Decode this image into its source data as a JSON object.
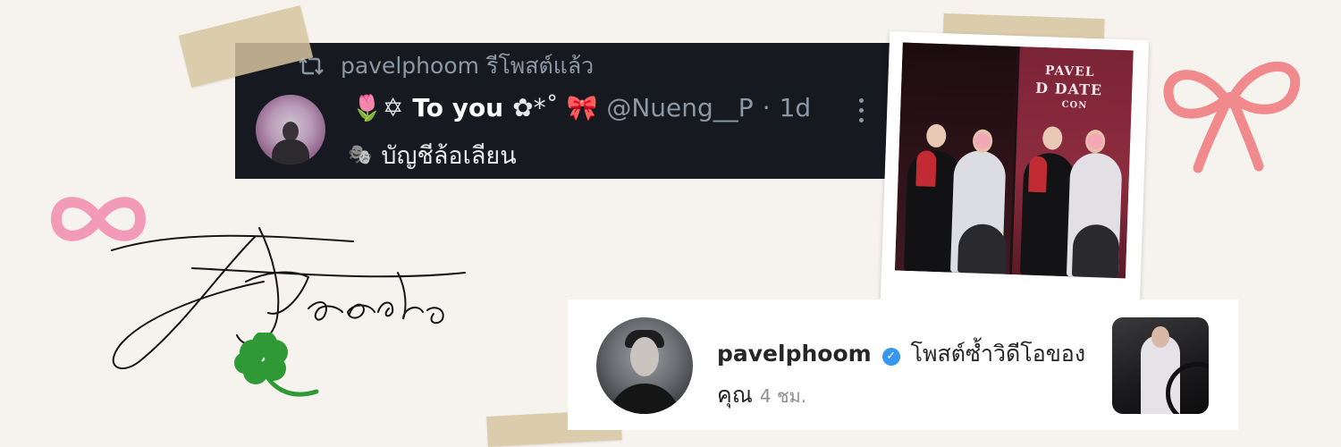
{
  "twitter": {
    "retweet_text": "pavelphoom รีโพสต์แล้ว",
    "display_name_prefix": "🌷✡",
    "display_name": "To you",
    "display_name_suffix": "✿*˚ 🎀",
    "handle": "@Nueng__P",
    "separator": "·",
    "time": "1d",
    "subtitle_icon": "🎭",
    "subtitle": "บัญชีล้อเลียน",
    "icons": {
      "retweet": "retweet-icon",
      "more": "more-vertical-icon"
    }
  },
  "polaroid": {
    "sign_text_1": "PAVEL",
    "sign_text_2": "D DATE",
    "sign_text_3": "CON"
  },
  "instagram": {
    "username": "pavelphoom",
    "message_1": "โพสต์ซ้ำวิดีโอของ",
    "message_2": "คุณ",
    "time": "4 ชม.",
    "icons": {
      "verified": "verified-badge-icon"
    }
  },
  "decor": {
    "signature": "Babecats",
    "colors": {
      "bow": "#f08a8c",
      "infinity": "#f39ab8",
      "clover": "#3aa23a",
      "tape": "#d6c4a0"
    }
  }
}
